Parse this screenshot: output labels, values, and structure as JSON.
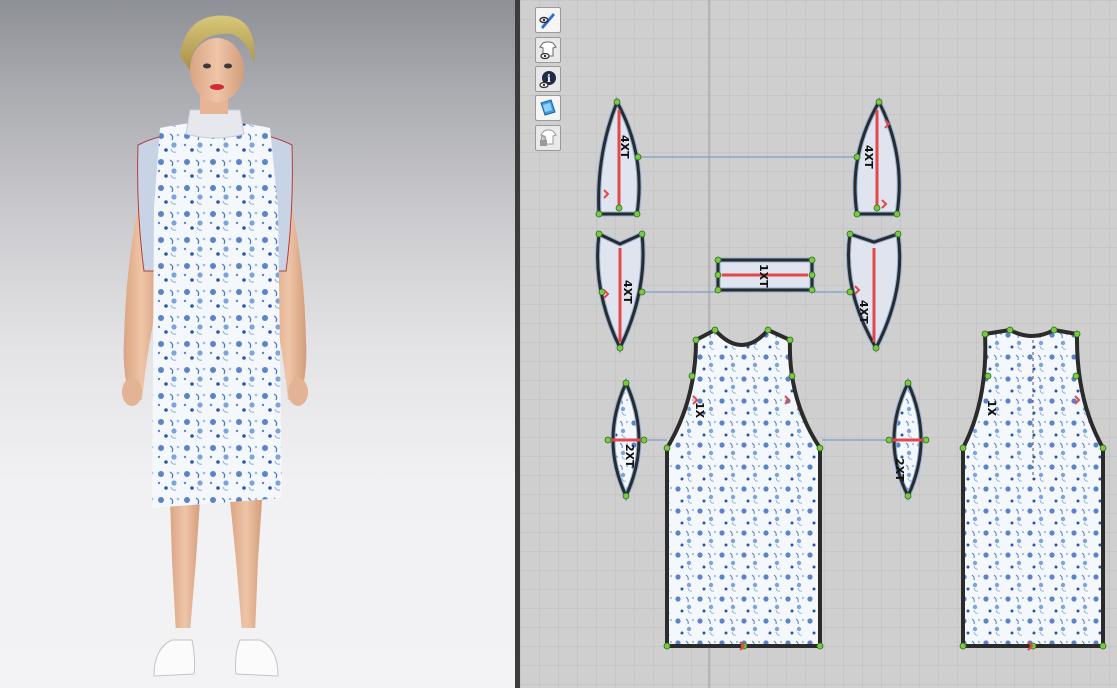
{
  "app": {
    "views": {
      "avatar_3d": "3D Garment View",
      "pattern_2d": "2D Pattern View"
    }
  },
  "toolbar_2d": [
    {
      "id": "show-3d-pen",
      "icon": "pen-eye-icon"
    },
    {
      "id": "show-garment",
      "icon": "garment-eye-icon"
    },
    {
      "id": "show-info",
      "icon": "info-eye-icon"
    },
    {
      "id": "show-texture",
      "icon": "texture-icon"
    },
    {
      "id": "lock-garment",
      "icon": "garment-lock-icon"
    }
  ],
  "pattern_labels": {
    "top_left_piece": "4XT",
    "top_right_piece": "4XT",
    "mid_left_piece": "4XT",
    "mid_strip": "1XT",
    "mid_right_piece": "4XT",
    "small_left_piece": "2XT",
    "small_right_piece": "2XT",
    "front_body": "1X",
    "back_body": "1X"
  },
  "colors": {
    "grid_bg": "#cfcfcf",
    "grid_line": "#bdbdbd",
    "outline": "#2b2b2b",
    "grain_line": "#e2474b",
    "point": "#7ac943",
    "link_line": "#8aa6c9",
    "fabric_base": "#f4f7fc",
    "fabric_print": "#3f6fc2"
  }
}
